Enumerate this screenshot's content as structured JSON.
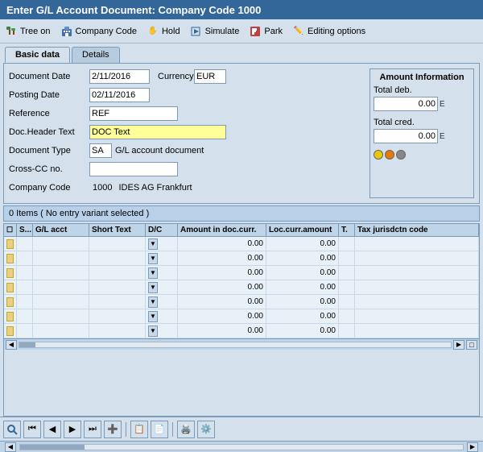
{
  "title": "Enter G/L Account Document: Company Code 1000",
  "toolbar": {
    "items": [
      {
        "label": "Tree on",
        "icon": "🌲"
      },
      {
        "label": "Company Code",
        "icon": "🏢"
      },
      {
        "label": "Hold",
        "icon": "✋"
      },
      {
        "label": "Simulate",
        "icon": "▶"
      },
      {
        "label": "Park",
        "icon": "💾"
      },
      {
        "label": "Editing options",
        "icon": "✏️"
      }
    ]
  },
  "tabs": [
    {
      "label": "Basic data",
      "active": true
    },
    {
      "label": "Details",
      "active": false
    }
  ],
  "form": {
    "document_date_label": "Document Date",
    "document_date_value": "2/11/2016",
    "currency_label": "Currency",
    "currency_value": "EUR",
    "posting_date_label": "Posting Date",
    "posting_date_value": "02/11/2016",
    "reference_label": "Reference",
    "reference_value": "REF",
    "doc_header_label": "Doc.Header Text",
    "doc_header_value": "DOC Text",
    "document_type_label": "Document Type",
    "document_type_value": "SA",
    "document_type_desc": "G/L account document",
    "cross_cc_label": "Cross-CC no.",
    "cross_cc_value": "",
    "company_code_label": "Company Code",
    "company_code_value": "1000",
    "company_code_desc": "IDES AG Frankfurt"
  },
  "amount_info": {
    "title": "Amount Information",
    "total_deb_label": "Total deb.",
    "total_deb_value": "0.00",
    "total_cred_label": "Total cred.",
    "total_cred_value": "0.00",
    "unit": "E"
  },
  "items_bar": {
    "text": "0 Items ( No entry variant selected )"
  },
  "table": {
    "columns": [
      "",
      "S...",
      "G/L acct",
      "Short Text",
      "D/C",
      "Amount in doc.curr.",
      "Loc.curr.amount",
      "T.",
      "Tax jurisdctn code"
    ],
    "rows": [
      {
        "amount": "0.00"
      },
      {
        "amount": "0.00"
      },
      {
        "amount": "0.00"
      },
      {
        "amount": "0.00"
      },
      {
        "amount": "0.00"
      },
      {
        "amount": "0.00"
      },
      {
        "amount": "0.00"
      }
    ]
  }
}
